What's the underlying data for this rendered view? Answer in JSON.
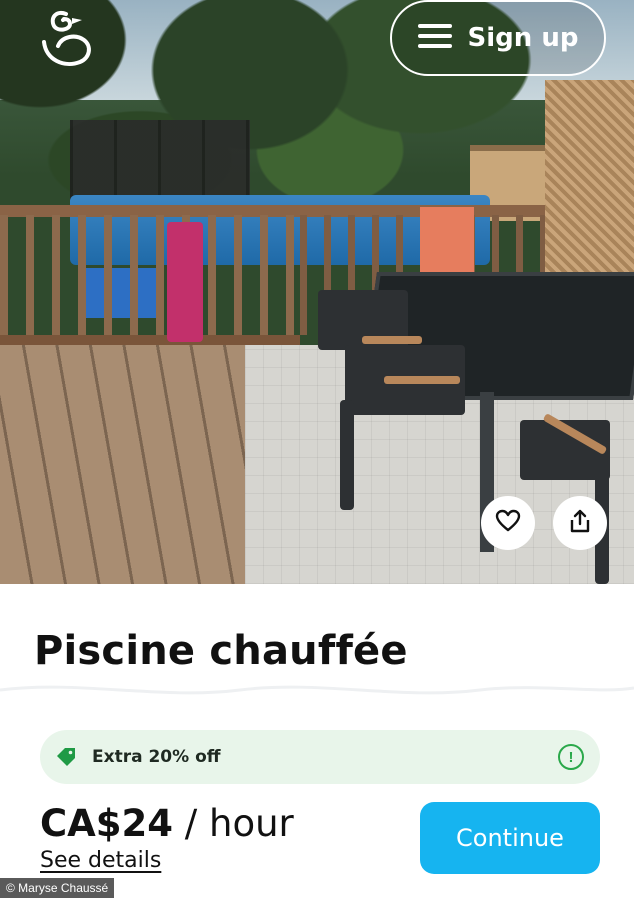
{
  "header": {
    "logo_icon": "duck-logo-icon",
    "menu_icon": "hamburger-menu-icon",
    "signup_label": "Sign up"
  },
  "photo_actions": {
    "favorite_icon": "heart-icon",
    "share_icon": "share-icon"
  },
  "listing": {
    "title": "Piscine chauffée",
    "promo_text": "Extra 20% off",
    "promo_icon": "tag-icon",
    "info_icon": "info-icon",
    "info_glyph": "!",
    "price": "CA$24",
    "price_unit": "/ hour",
    "details_link": "See details",
    "continue_label": "Continue"
  },
  "credit": "© Maryse Chaussé",
  "colors": {
    "accent": "#16b4f0",
    "promo_bg": "#e8f5ea",
    "promo_green": "#2aa84a",
    "tag_green": "#1f9a45"
  }
}
